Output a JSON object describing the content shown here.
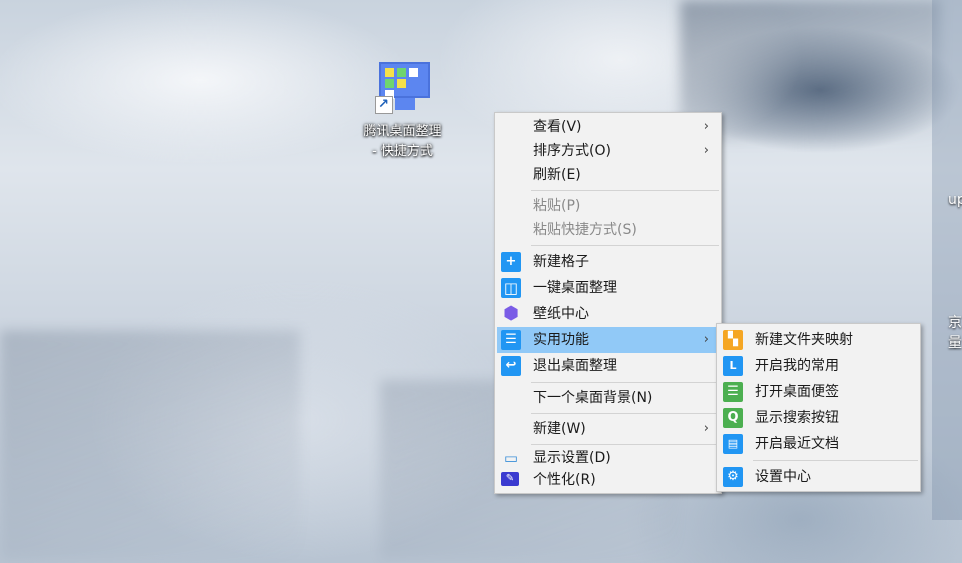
{
  "desktop": {
    "shortcut_label_line1": "腾讯桌面整理",
    "shortcut_label_line2": "- 快捷方式",
    "side_text": [
      "up",
      "京",
      "量"
    ]
  },
  "context_menu": {
    "items": [
      {
        "label": "查看(V)",
        "submenu": true
      },
      {
        "label": "排序方式(O)",
        "submenu": true
      },
      {
        "label": "刷新(E)"
      },
      {
        "label": "粘贴(P)",
        "disabled": true
      },
      {
        "label": "粘贴快捷方式(S)",
        "disabled": true
      },
      {
        "label": "新建格子",
        "icon": "plus-icon"
      },
      {
        "label": "一键桌面整理",
        "icon": "layout-icon"
      },
      {
        "label": "壁纸中心",
        "icon": "cube-icon"
      },
      {
        "label": "实用功能",
        "icon": "list-icon",
        "submenu": true,
        "highlighted": true
      },
      {
        "label": "退出桌面整理",
        "icon": "exit-icon"
      },
      {
        "label": "下一个桌面背景(N)"
      },
      {
        "label": "新建(W)",
        "submenu": true
      },
      {
        "label": "显示设置(D)",
        "icon": "display-icon"
      },
      {
        "label": "个性化(R)",
        "icon": "personalize-icon"
      }
    ]
  },
  "submenu": {
    "items": [
      {
        "label": "新建文件夹映射",
        "icon": "folder-map-icon",
        "color": "#f5a623"
      },
      {
        "label": "开启我的常用",
        "icon": "clock-icon",
        "color": "#2196f3"
      },
      {
        "label": "打开桌面便签",
        "icon": "note-icon",
        "color": "#4caf50"
      },
      {
        "label": "显示搜索按钮",
        "icon": "search-icon",
        "color": "#4caf50"
      },
      {
        "label": "开启最近文档",
        "icon": "document-icon",
        "color": "#2196f3"
      },
      {
        "label": "设置中心",
        "icon": "gear-icon",
        "color": "#2196f3"
      }
    ]
  },
  "colors": {
    "highlight": "#91c9f7",
    "accent": "#2196f3"
  }
}
